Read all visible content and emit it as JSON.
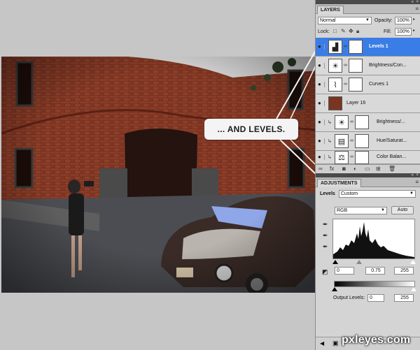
{
  "callout": {
    "text": "... AND LEVELS."
  },
  "watermark": {
    "text": "pxleyes.com"
  },
  "colors": {
    "selection": "#3b7de6",
    "panel_bg": "#d4d4d4",
    "workspace_bg": "#c6c6c6"
  },
  "layers_panel": {
    "tab_label": "LAYERS",
    "blend_mode": "Normal",
    "opacity_label": "Opacity:",
    "opacity_value": "100%",
    "lock_label": "Lock:",
    "fill_label": "Fill:",
    "fill_value": "100%",
    "layers": [
      {
        "name": "Levels 1",
        "icon": "levels-adjustment-icon",
        "selected": true,
        "clipped": false
      },
      {
        "name": "Brightness/Con...",
        "icon": "brightness-contrast-icon",
        "selected": false,
        "clipped": false
      },
      {
        "name": "Curves 1",
        "icon": "curves-icon",
        "selected": false,
        "clipped": false
      },
      {
        "name": "Layer 16",
        "icon": "image-thumbnail",
        "selected": false,
        "clipped": false
      },
      {
        "name": "Brightness/...",
        "icon": "brightness-contrast-icon",
        "selected": false,
        "clipped": true
      },
      {
        "name": "Hue/Saturat...",
        "icon": "hue-saturation-icon",
        "selected": false,
        "clipped": true
      },
      {
        "name": "Color Balan...",
        "icon": "color-balance-icon",
        "selected": false,
        "clipped": true
      }
    ]
  },
  "adjustments_panel": {
    "tab_label": "ADJUSTMENTS",
    "title": "Levels",
    "preset": "Custom",
    "channel": "RGB",
    "auto_label": "Auto",
    "input_black": "0",
    "input_gamma": "0.75",
    "input_white": "255",
    "output_label": "Output Levels:",
    "output_black": "0",
    "output_white": "255"
  }
}
